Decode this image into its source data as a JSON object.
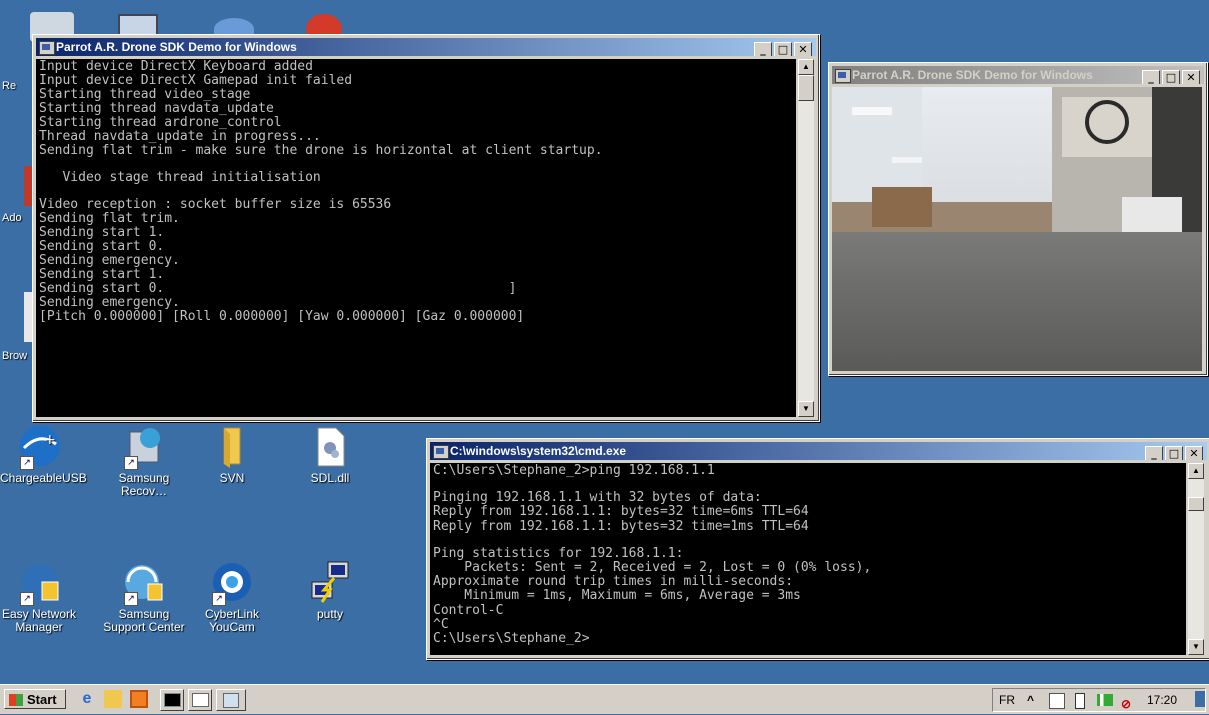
{
  "desktop": {
    "partial_labels": {
      "re": "Re",
      "ado": "Ado",
      "brow": "Brow"
    },
    "icons": [
      {
        "label": "ChargeableUSB",
        "icon": "usb-charge-icon"
      },
      {
        "label": "Samsung Recov…",
        "icon": "samsung-recovery-icon"
      },
      {
        "label": "SVN",
        "icon": "folder-icon"
      },
      {
        "label": "SDL.dll",
        "icon": "dll-file-icon"
      },
      {
        "label": "Easy Network Manager",
        "icon": "network-manager-icon"
      },
      {
        "label": "Samsung Support Center",
        "icon": "support-center-icon"
      },
      {
        "label": "CyberLink YouCam",
        "icon": "webcam-icon"
      },
      {
        "label": "putty",
        "icon": "putty-icon"
      }
    ]
  },
  "sdk_console": {
    "title": "Parrot A.R. Drone SDK Demo for Windows",
    "lines": [
      "Input device DirectX Keyboard added",
      "Input device DirectX Gamepad init failed",
      "Starting thread video_stage",
      "Starting thread navdata_update",
      "Starting thread ardrone_control",
      "Thread navdata_update in progress...",
      "Sending flat trim - make sure the drone is horizontal at client startup.",
      "",
      "   Video stage thread initialisation",
      "",
      "Video reception : socket buffer size is 65536",
      "Sending flat trim.",
      "Sending start 1.",
      "Sending start 0.",
      "Sending emergency.",
      "Sending start 1.",
      "Sending start 0.                                            ]",
      "Sending emergency.",
      "[Pitch 0.000000] [Roll 0.000000] [Yaw 0.000000] [Gaz 0.000000]"
    ]
  },
  "video_window": {
    "title": "Parrot A.R. Drone SDK Demo for Windows"
  },
  "cmd_window": {
    "title": "C:\\windows\\system32\\cmd.exe",
    "lines": [
      "C:\\Users\\Stephane_2>ping 192.168.1.1",
      "",
      "Pinging 192.168.1.1 with 32 bytes of data:",
      "Reply from 192.168.1.1: bytes=32 time=6ms TTL=64",
      "Reply from 192.168.1.1: bytes=32 time=1ms TTL=64",
      "",
      "Ping statistics for 192.168.1.1:",
      "    Packets: Sent = 2, Received = 2, Lost = 0 (0% loss),",
      "Approximate round trip times in milli-seconds:",
      "    Minimum = 1ms, Maximum = 6ms, Average = 3ms",
      "Control-C",
      "^C",
      "C:\\Users\\Stephane_2>"
    ]
  },
  "window_buttons": {
    "minimize": "_",
    "maximize": "□",
    "close": "✕"
  },
  "taskbar": {
    "start_label": "Start",
    "language": "FR",
    "tray_chevron": "^",
    "clock": "17:20"
  }
}
